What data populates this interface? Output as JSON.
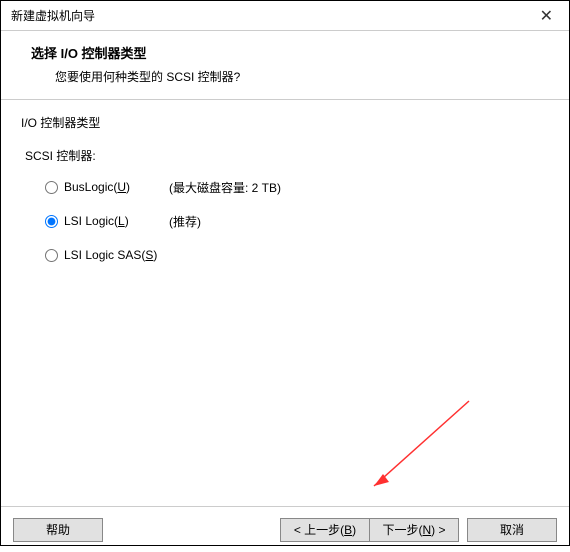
{
  "titlebar": {
    "title": "新建虚拟机向导"
  },
  "header": {
    "title": "选择 I/O 控制器类型",
    "subtitle": "您要使用何种类型的 SCSI 控制器?"
  },
  "content": {
    "section_label": "I/O 控制器类型",
    "subsection_label": "SCSI 控制器:",
    "options": [
      {
        "label_pre": "BusLogic(",
        "key": "U",
        "label_post": ")",
        "note": "(最大磁盘容量: 2 TB)",
        "selected": false
      },
      {
        "label_pre": "LSI Logic(",
        "key": "L",
        "label_post": ")",
        "note": "(推荐)",
        "selected": true
      },
      {
        "label_pre": "LSI Logic SAS(",
        "key": "S",
        "label_post": ")",
        "note": "",
        "selected": false
      }
    ]
  },
  "footer": {
    "help": "帮助",
    "back_pre": "< 上一步(",
    "back_key": "B",
    "back_post": ")",
    "next_pre": "下一步(",
    "next_key": "N",
    "next_post": ") >",
    "cancel": "取消"
  }
}
